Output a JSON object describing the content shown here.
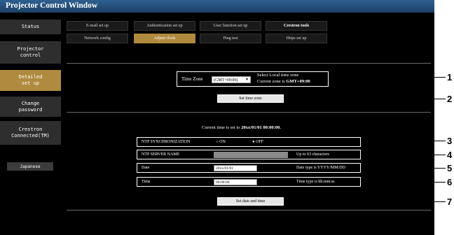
{
  "window": {
    "title": "Projector Control Window"
  },
  "sidebar": {
    "items": [
      {
        "label": "Status"
      },
      {
        "label": "Projector\ncontrol"
      },
      {
        "label": "Detailed\nset up"
      },
      {
        "label": "Change\npassword"
      },
      {
        "label": "Crestron\nConnected(TM)"
      }
    ],
    "language_button": "Japanese"
  },
  "nav": {
    "row1": [
      "E-mail set up",
      "Authentication set up",
      "User function set up",
      "Crestron tools"
    ],
    "row2": [
      "Network config",
      "Adjust clock",
      "Ping test",
      "Https set up"
    ]
  },
  "timezone": {
    "label": "Time Zone",
    "selected": "(GMT+09:00)",
    "hint_line1": "Select Local time zone",
    "hint_line2_prefix": "Current zone is ",
    "hint_line2_value": "GMT+09:00",
    "set_button": "Set time zone"
  },
  "current_time": {
    "prefix": "Current time is set to ",
    "value": "20xx/01/01 00:00:00."
  },
  "settings": {
    "ntp_sync": {
      "label": "NTP SYNCHRONIZATION",
      "option_on": "ON",
      "option_off": "OFF",
      "selected": "OFF"
    },
    "ntp_server": {
      "label": "NTP SERVER NAME",
      "value": "",
      "note": "Up to 63 characters"
    },
    "date": {
      "label": "Date",
      "value": "20xx/01/01",
      "note": "Date type is YYYY/MM/DD"
    },
    "time": {
      "label": "Time",
      "value": "00:00:00",
      "note": "Time type is hh:mm:ss"
    },
    "submit_button": "Set date and time"
  },
  "callouts": [
    "1",
    "2",
    "3",
    "4",
    "5",
    "6",
    "7"
  ]
}
